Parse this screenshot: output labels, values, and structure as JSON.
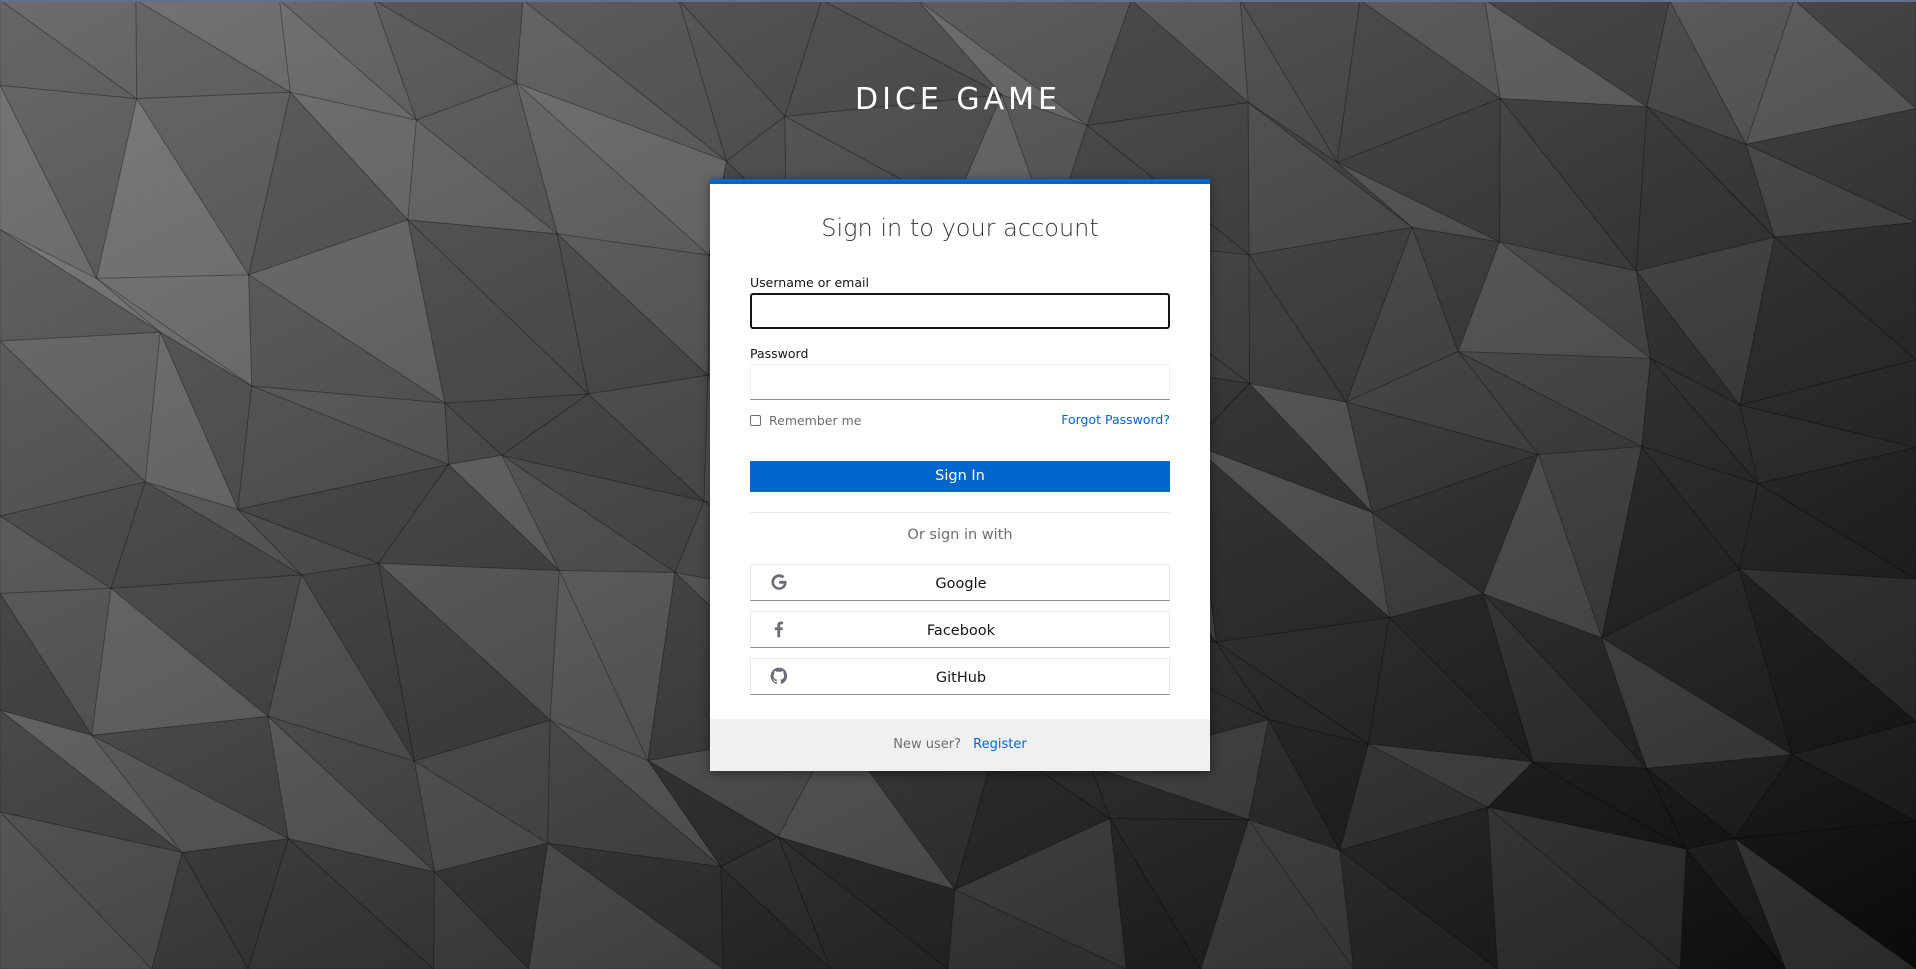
{
  "realm": {
    "title": "DICE GAME"
  },
  "login": {
    "title": "Sign in to your account",
    "username_label": "Username or email",
    "username_value": "",
    "password_label": "Password",
    "password_value": "",
    "remember_label": "Remember me",
    "remember_checked": false,
    "forgot_label": "Forgot Password?",
    "signin_label": "Sign In",
    "or_sign_in_with": "Or sign in with"
  },
  "social": [
    {
      "label": "Google",
      "icon": "google-icon"
    },
    {
      "label": "Facebook",
      "icon": "facebook-icon"
    },
    {
      "label": "GitHub",
      "icon": "github-icon"
    }
  ],
  "footer": {
    "new_user": "New user?",
    "register": "Register"
  },
  "colors": {
    "accent": "#0066cc",
    "link": "#0066cc",
    "background_light": "#7a7a7a",
    "background_dark": "#0a0a0a",
    "footer_bg": "#f0f0f0"
  }
}
